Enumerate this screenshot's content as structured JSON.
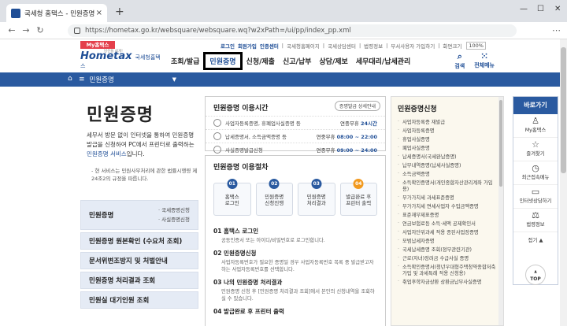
{
  "browser": {
    "tab_title": "국세청 홈택스 - 민원증명",
    "url": "https://hometax.go.kr/websquare/websquare.wq?w2xPath=/ui/pp/index_pp.xml",
    "new_tab": "+",
    "close": "×"
  },
  "header": {
    "my_tag": "My홈택스",
    "logo": "Hometax",
    "logo_sub": "국세청홈택스",
    "logo_slogan": "당신을 쉽게!",
    "util_links": [
      "로그인",
      "회원가입",
      "인증센터",
      "국세청홈페이지",
      "국세상담센터",
      "법령정보",
      "부서사용자 가입하기",
      "화면크기"
    ],
    "zoom": "100%",
    "gnb": [
      "조회/발급",
      "민원증명",
      "신청/제출",
      "신고/납부",
      "상담/제보",
      "세무대리/납세관리"
    ],
    "active_gnb": "민원증명",
    "icons": [
      {
        "label": "검색",
        "icon": "search-icon"
      },
      {
        "label": "전체메뉴",
        "icon": "grid-icon"
      }
    ]
  },
  "locbar": {
    "label": "민원증명"
  },
  "left": {
    "title": "민원증명",
    "intro_1": "세무서 방문 없이 인터넷을 통하여 민원증명발급을 신청하여 PC에서 프린터로 출력하는 ",
    "intro_link": "민원증명 서비스",
    "intro_2": "입니다.",
    "note": "- 현 서비스는 민원사무처리에 관한 법률시행령 제24조2의 규정을 따릅니다.",
    "nav_first": "민원증명",
    "nav_first_subs": [
      "국세증명신청",
      "사실증명신청"
    ],
    "nav": [
      "민원증명 원본확인 (수요처 조회)",
      "문서위변조방지 및 처벌안내",
      "민원증명 처리결과 조회",
      "민원실 대기인원 조회"
    ]
  },
  "hours": {
    "title": "민원증명 이용시간",
    "detail_btn": "증명발급 상세안내",
    "rows": [
      {
        "label": "사업자등록증명, 휴폐업사실증명 등",
        "prefix": "연중무휴 ",
        "value": "24시간"
      },
      {
        "label": "납세증명서, 소득금액증명 등",
        "prefix": "연중무휴 ",
        "value": "08:00 ~ 22:00"
      },
      {
        "label": "사실증명발급신청",
        "prefix": "연중무휴 ",
        "value": "09:00 ~ 24:00"
      }
    ]
  },
  "procedure": {
    "title": "민원증명 이용절차",
    "steps": [
      {
        "num": "01",
        "text": "홈택스\n로그인",
        "color": "#2a5aa0"
      },
      {
        "num": "02",
        "text": "민원증명\n신청진행",
        "color": "#2a5aa0"
      },
      {
        "num": "03",
        "text": "민원증명\n처리결과",
        "color": "#2a5aa0"
      },
      {
        "num": "04",
        "text": "발급완료 후\n프린터 출력",
        "color": "#f29a1f"
      }
    ],
    "items": [
      {
        "h": "01 홈택스 로그인",
        "p": "공동인증서 또는 아이디/비밀번호로 로그인합니다."
      },
      {
        "h": "02 민원증명신청",
        "p": "사업자등록번호가 필요한 증명일 경우 사업자등록번호 목록 중 발급받고자 하는 사업자등록번호를 선택합니다."
      },
      {
        "h": "03 나의 민원증명 처리결과",
        "p": "민원증명 신청 후 [민원증명 처리결과 조회]에서 본인의 신청내역을 조회하실 수 있습니다."
      },
      {
        "h": "04 발급완료 후 프린터 출력",
        "p": ""
      }
    ]
  },
  "rlist": {
    "title": "민원증명신청",
    "items": [
      "사업자등록증 재발급",
      "사업자등록증명",
      "휴업사실증명",
      "폐업사실증명",
      "납세증명서(국세완납증명)",
      "납부내역증명(납세사실증명)",
      "소득금액증명",
      "소득확인증명서(개인종합자산관리계좌 가입용)",
      "부가가치세 과세표준증명",
      "부가가치세 면세사업자 수입금액증명",
      "표준재무제표증명",
      "연금보험료등 소득·세액 공제확인서",
      "사업자단위과세 적용 종된사업장증명",
      "모범납세자증명",
      "국세납세증명 조회(정부관련기관)",
      "근로(자녀)장려금 수급사실 증명",
      "소득확인증명서(청년우대형주택청약종합저축 가입 및 과세특례 적용 신청용)",
      "취업후학자금상환 상환금납부사실증명"
    ]
  },
  "quick": {
    "header": "바로가기",
    "items": [
      {
        "label": "My홈택스",
        "icon": "person-icon"
      },
      {
        "label": "즐겨찾기",
        "icon": "star-icon"
      },
      {
        "label": "최근접속메뉴",
        "icon": "clock-icon"
      },
      {
        "label": "인터넷상담하기",
        "icon": "chat-icon"
      },
      {
        "label": "법령정보",
        "icon": "scale-icon"
      }
    ],
    "more": "접기 ▲",
    "top": "TOP"
  }
}
